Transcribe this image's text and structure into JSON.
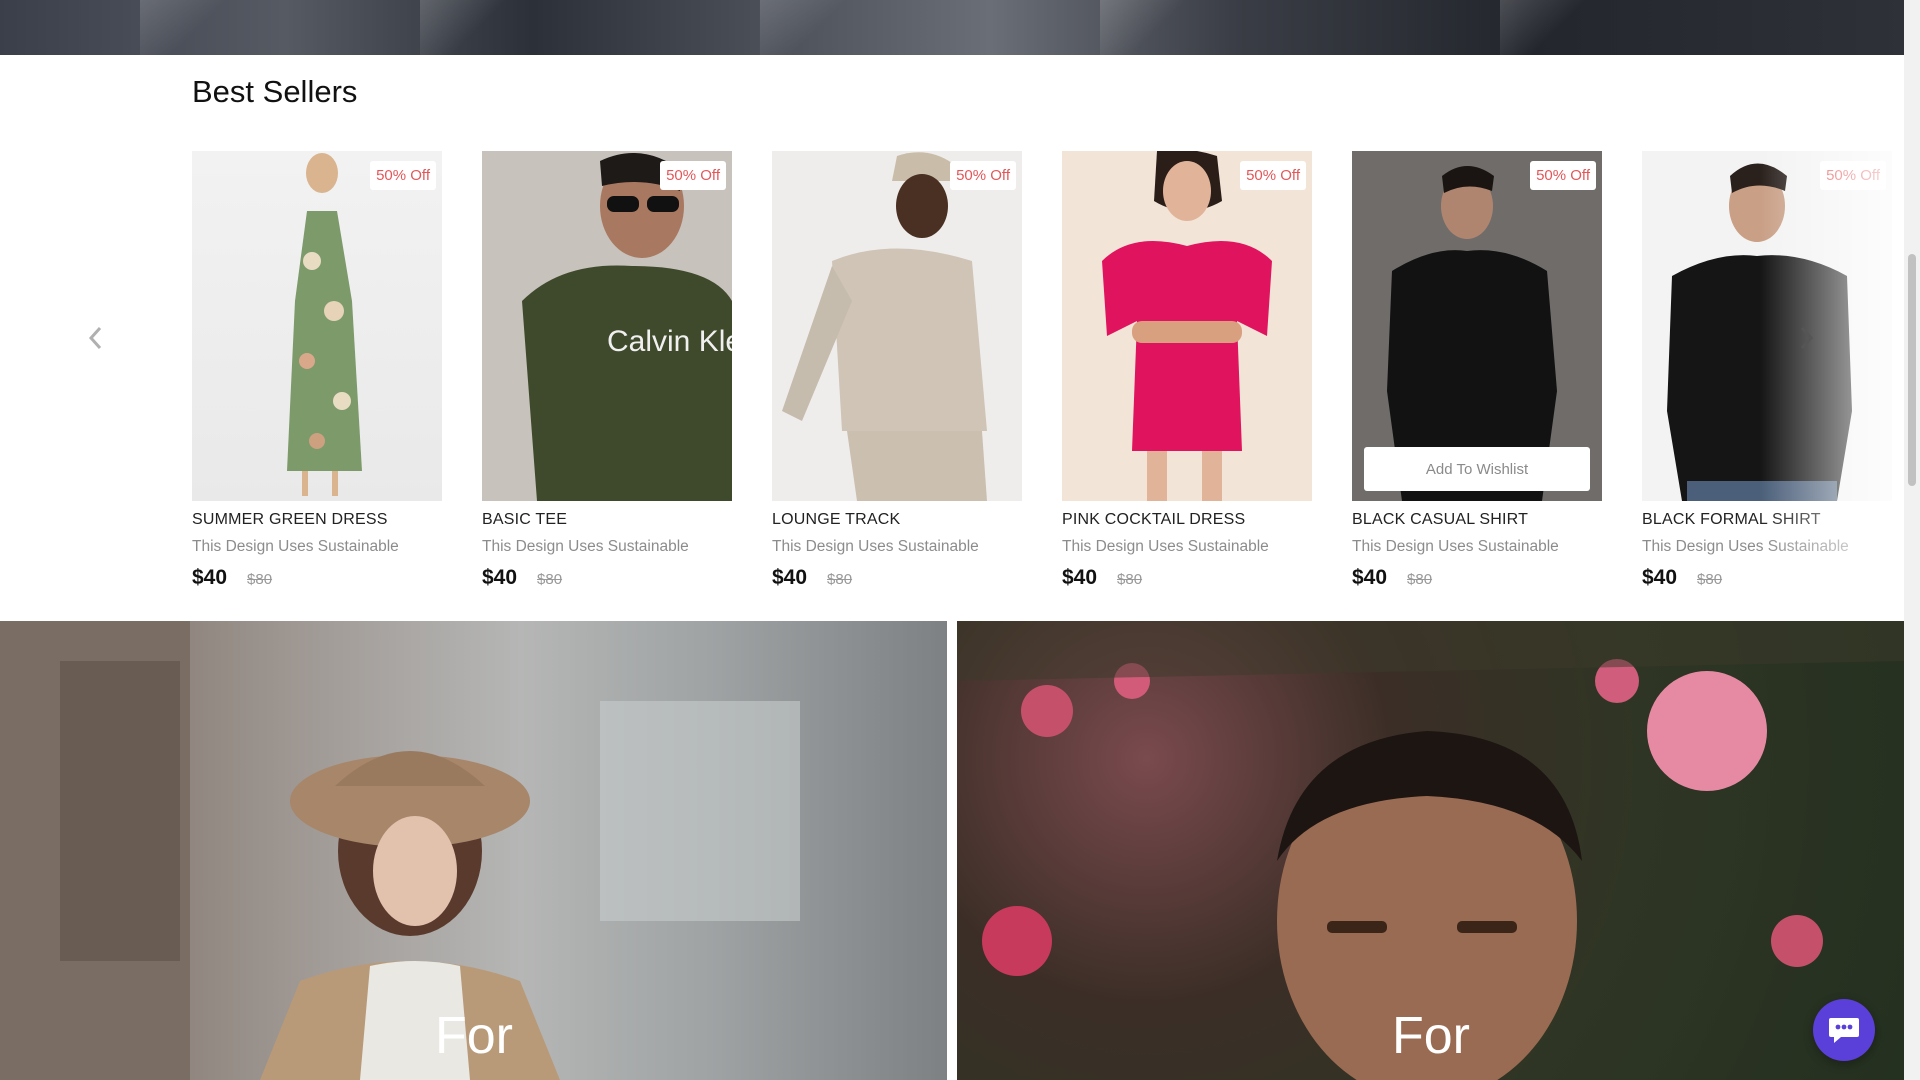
{
  "section": {
    "title": "Best Sellers"
  },
  "carousel": {
    "prev_icon": "chevron-left-icon",
    "next_icon": "chevron-right-icon",
    "products": [
      {
        "name": "SUMMER GREEN DRESS",
        "description": "This Design Uses Sustainable",
        "price": "$40",
        "old_price": "$80",
        "badge": "50% Off"
      },
      {
        "name": "BASIC TEE",
        "description": "This Design Uses Sustainable",
        "price": "$40",
        "old_price": "$80",
        "badge": "50% Off"
      },
      {
        "name": "LOUNGE TRACK",
        "description": "This Design Uses Sustainable",
        "price": "$40",
        "old_price": "$80",
        "badge": "50% Off"
      },
      {
        "name": "PINK COCKTAIL DRESS",
        "description": "This Design Uses Sustainable",
        "price": "$40",
        "old_price": "$80",
        "badge": "50% Off"
      },
      {
        "name": "BLACK CASUAL SHIRT",
        "description": "This Design Uses Sustainable",
        "price": "$40",
        "old_price": "$80",
        "badge": "50% Off",
        "wishlist_label": "Add To Wishlist"
      },
      {
        "name": "BLACK FORMAL SHIRT",
        "description": "This Design Uses Sustainable",
        "price": "$40",
        "old_price": "$80",
        "badge": "50% Off"
      }
    ]
  },
  "banners": {
    "women": {
      "label": "For"
    },
    "men": {
      "label": "For"
    }
  },
  "chat": {
    "icon": "chat-bubble-icon",
    "color": "#5a3fd8"
  },
  "colors": {
    "badge_text": "#e2585a",
    "accent": "#5a3fd8"
  }
}
